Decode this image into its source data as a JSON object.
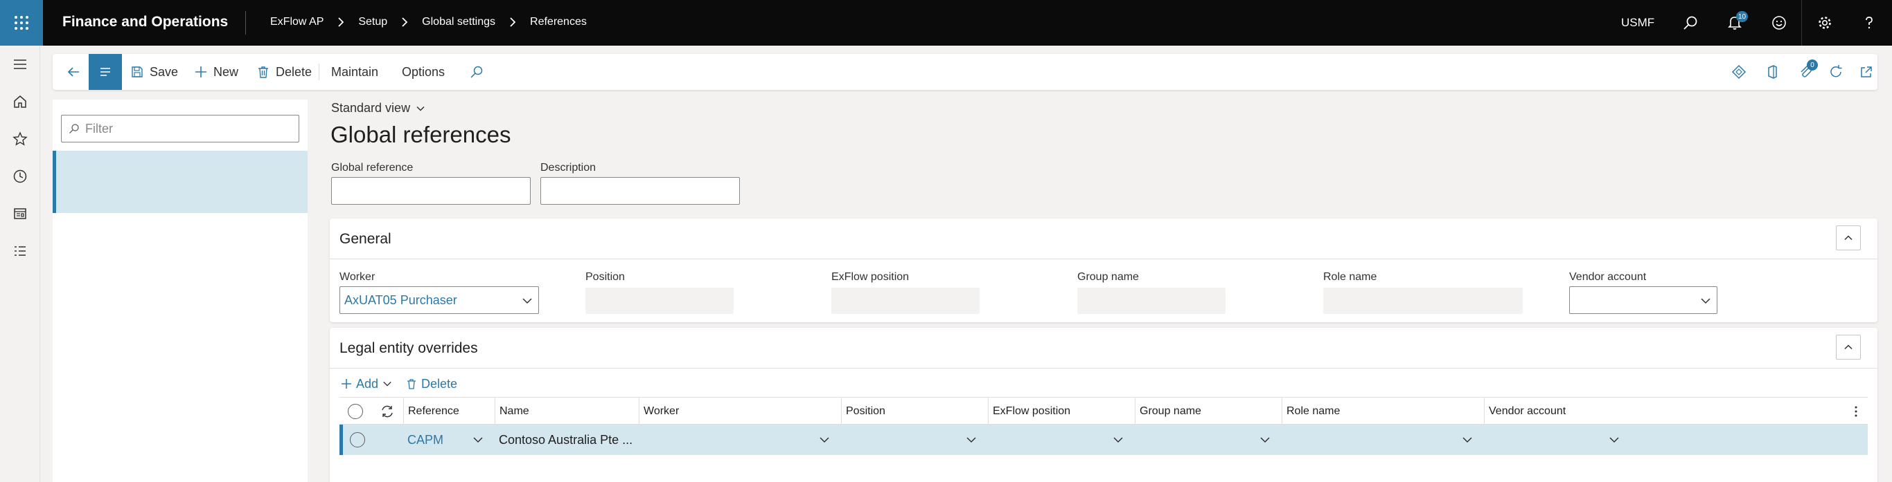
{
  "topbar": {
    "app_title": "Finance and Operations",
    "breadcrumbs": [
      "ExFlow AP",
      "Setup",
      "Global settings",
      "References"
    ],
    "company": "USMF",
    "notification_count": "10"
  },
  "actions": {
    "save": "Save",
    "new": "New",
    "delete": "Delete",
    "maintain": "Maintain",
    "options": "Options",
    "attachments_count": "0"
  },
  "list": {
    "filter_placeholder": "Filter"
  },
  "page": {
    "view": "Standard view",
    "title": "Global references",
    "fields": {
      "global_reference_label": "Global reference",
      "global_reference_value": "",
      "description_label": "Description",
      "description_value": ""
    }
  },
  "general": {
    "header": "General",
    "worker_label": "Worker",
    "worker_value": "AxUAT05 Purchaser",
    "position_label": "Position",
    "exflow_position_label": "ExFlow position",
    "group_name_label": "Group name",
    "role_name_label": "Role name",
    "vendor_account_label": "Vendor account"
  },
  "overrides": {
    "header": "Legal entity overrides",
    "add_label": "Add",
    "delete_label": "Delete",
    "columns": [
      "Reference",
      "Name",
      "Worker",
      "Position",
      "ExFlow position",
      "Group name",
      "Role name",
      "Vendor account"
    ],
    "rows": [
      {
        "reference": "CAPM",
        "name": "Contoso Australia Pte ...",
        "worker": "",
        "position": "",
        "exflow_position": "",
        "group_name": "",
        "role_name": "",
        "vendor_account": ""
      }
    ]
  },
  "colors": {
    "accent": "#2b79a8",
    "topbar": "#0b0b0b",
    "selected_row": "#d4e7ee"
  }
}
